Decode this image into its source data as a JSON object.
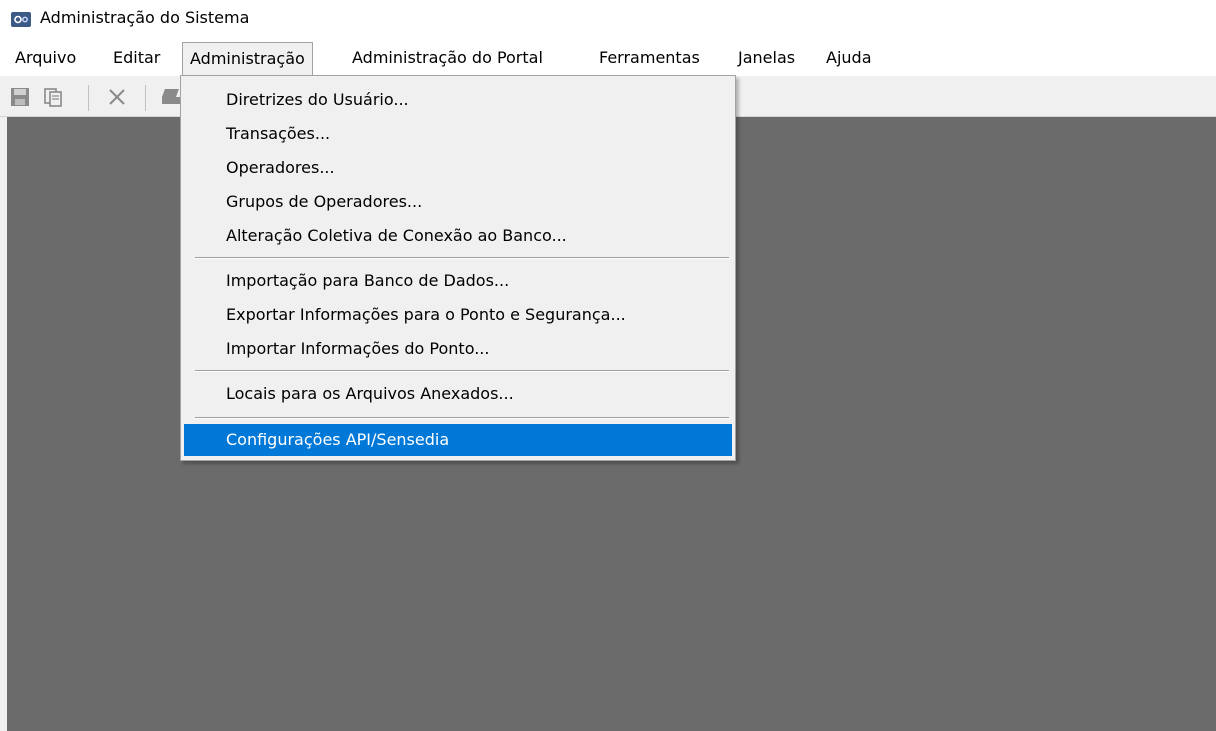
{
  "window": {
    "title": "Administração do Sistema",
    "icon": "app-gear-icon"
  },
  "menubar": {
    "items": [
      {
        "label": "Arquivo"
      },
      {
        "label": "Editar"
      },
      {
        "label": "Administração"
      },
      {
        "label": "Administração do Portal"
      },
      {
        "label": "Ferramentas"
      },
      {
        "label": "Janelas"
      },
      {
        "label": "Ajuda"
      }
    ],
    "open_menu": "Administração"
  },
  "toolbar": {
    "buttons": [
      "save-icon",
      "copy-icon",
      "delete-icon",
      "print-icon"
    ]
  },
  "dropdown": {
    "items": [
      {
        "label": "Diretrizes do Usuário..."
      },
      {
        "label": "Transações..."
      },
      {
        "label": "Operadores..."
      },
      {
        "label": "Grupos de Operadores..."
      },
      {
        "label": "Alteração Coletiva de Conexão ao Banco..."
      },
      {
        "label": "Importação para Banco de Dados..."
      },
      {
        "label": "Exportar Informações para o Ponto e Segurança..."
      },
      {
        "label": "Importar Informações do Ponto..."
      },
      {
        "label": "Locais para os Arquivos Anexados..."
      },
      {
        "label": "Configurações API/Sensedia",
        "selected": true
      }
    ]
  },
  "colors": {
    "selection": "#0078d7",
    "workspace": "#6b6b6b",
    "menu_bg": "#f0f0f0"
  }
}
